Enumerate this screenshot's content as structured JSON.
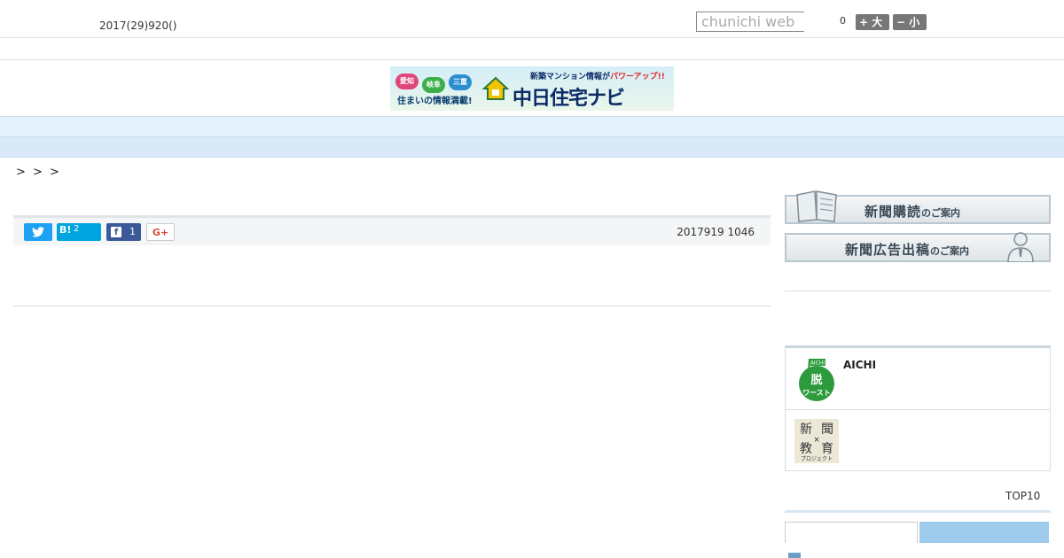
{
  "header": {
    "date": "2017(29)920()",
    "search_placeholder": "chunichi web",
    "font_size_value": "0",
    "font_large_label": "+ 大",
    "font_small_label": "− 小"
  },
  "banner": {
    "bubbles": [
      "愛知",
      "岐阜",
      "三重"
    ],
    "tagline": "住まいの情報満載!",
    "brand": "中日住宅ナビ",
    "catch_prefix": "新築マンション情報が",
    "catch_highlight": "パワーアップ!!"
  },
  "nav": {
    "items": [
      "",
      "",
      "",
      "",
      "",
      "",
      "",
      "",
      ""
    ]
  },
  "breadcrumb": "> > >",
  "share": {
    "twitter_icon": "twitter-icon",
    "hatena_label": "B!",
    "hatena_count": "2",
    "facebook_count": "1",
    "google_label": "G+",
    "published": "2017919 1046"
  },
  "sidebar": {
    "subscribe_main": "新聞購読",
    "subscribe_suffix": "のご案内",
    "advertise_main": "新聞広告出稿",
    "advertise_suffix": "のご案内",
    "promo1_icon_text": "AICHI",
    "promo1_icon_main": "脱",
    "promo1_icon_sub": "ワースト",
    "promo1_title": "AICHI",
    "promo2_icon_text": [
      "新",
      "聞",
      "教",
      "育"
    ],
    "promo2_icon_sub": "プロジェクト",
    "top10_label": "TOP10",
    "rank_first": "1"
  },
  "colors": {
    "nav_bg": "#e4f0fb",
    "band_bg": "#d9e9f8",
    "twitter": "#1da1f2",
    "hatena": "#00a4de",
    "facebook": "#3b5998",
    "tab_inactive": "#9fcbed"
  }
}
